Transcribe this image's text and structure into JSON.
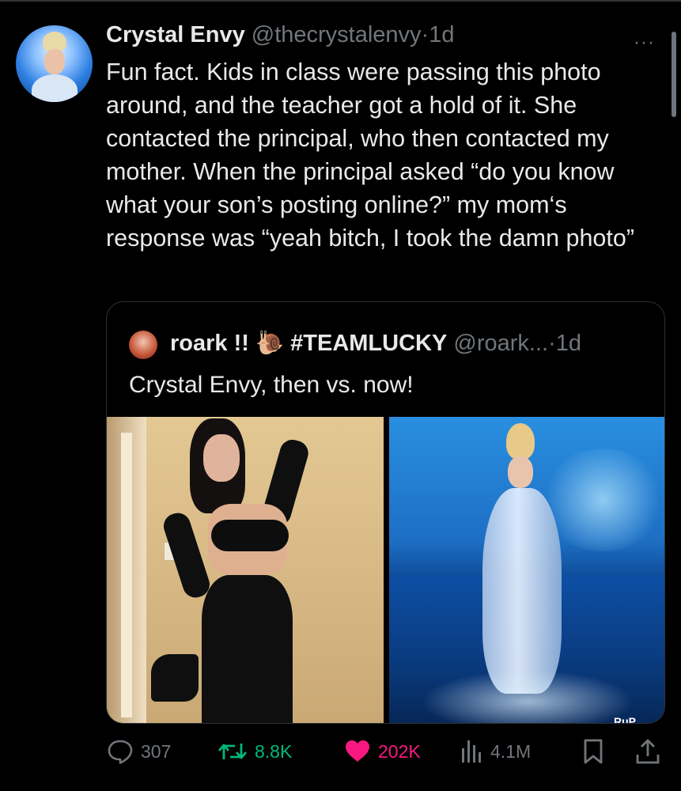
{
  "tweet": {
    "author_name": "Crystal Envy",
    "handle": "@thecrystalenvy",
    "separator": "·",
    "time": "1d",
    "more_label": "···",
    "text": "Fun fact. Kids in class were passing this photo around, and the teacher got a hold of it. She contacted the principal, who then contacted my mother. When the principal asked “do you know what your son’s posting online?” my mom‘s response was “yeah bitch, I took the damn photo”"
  },
  "quote": {
    "author_name": "roark !! 🐌 #TEAMLUCKY",
    "handle": "@roark...",
    "separator": "·",
    "time": "1d",
    "text": "Crystal Envy, then vs. now!",
    "media_watermark": "RuP"
  },
  "actions": {
    "replies": "307",
    "retweets": "8.8K",
    "likes": "202K",
    "views": "4.1M"
  },
  "icons": {
    "reply": "speech-bubble-icon",
    "retweet": "retweet-arrows-icon",
    "like": "heart-icon",
    "views": "bar-chart-icon",
    "bookmark": "bookmark-icon",
    "share": "share-upload-icon"
  },
  "colors": {
    "background": "#000000",
    "text": "#e7e9ea",
    "secondary": "#71767b",
    "retweet_green": "#00ba7c",
    "like_pink": "#f91880",
    "border": "#2f3336"
  }
}
